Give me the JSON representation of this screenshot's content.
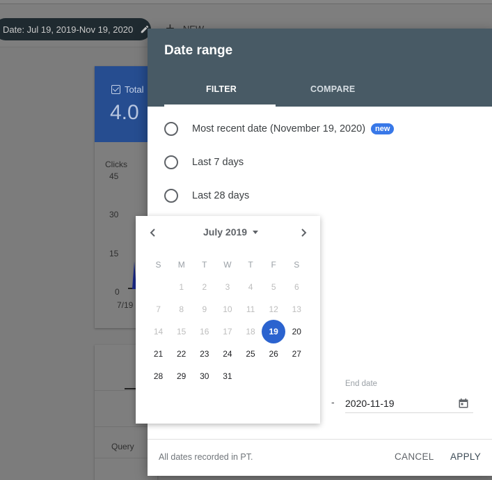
{
  "background": {
    "date_chip": "Date: Jul 19, 2019-Nov 19, 2020",
    "new_button": "NEW",
    "metric_card": {
      "checkbox_label": "Total",
      "value_partial": "4.0",
      "chart_label": "Clicks",
      "y_ticks": [
        "45",
        "30",
        "15",
        "0"
      ],
      "x_tick_partial": "7/19"
    },
    "table": {
      "header_partial": "Query"
    },
    "colors": {
      "card_accent": "#264d90"
    }
  },
  "dialog": {
    "title": "Date range",
    "tabs": [
      {
        "label": "FILTER",
        "active": true
      },
      {
        "label": "COMPARE",
        "active": false
      }
    ],
    "options": [
      {
        "label": "Most recent date (November 19, 2020)",
        "badge": "new",
        "selected": false
      },
      {
        "label": "Last 7 days",
        "selected": false
      },
      {
        "label": "Last 28 days",
        "selected": false
      }
    ],
    "end_date": {
      "label": "End date",
      "value": "2020-11-19",
      "separator": "-"
    },
    "footer_note": "All dates recorded in PT.",
    "cancel_label": "CANCEL",
    "apply_label": "APPLY",
    "colors": {
      "header_bg": "#485a65",
      "badge": "#3878e8"
    }
  },
  "calendar": {
    "month_label": "July 2019",
    "weekdays": [
      "S",
      "M",
      "T",
      "W",
      "T",
      "F",
      "S"
    ],
    "weeks": [
      [
        "",
        "1",
        "2",
        "3",
        "4",
        "5",
        "6"
      ],
      [
        "7",
        "8",
        "9",
        "10",
        "11",
        "12",
        "13"
      ],
      [
        "14",
        "15",
        "16",
        "17",
        "18",
        "19",
        "20"
      ],
      [
        "21",
        "22",
        "23",
        "24",
        "25",
        "26",
        "27"
      ],
      [
        "28",
        "29",
        "30",
        "31",
        "",
        "",
        ""
      ]
    ],
    "selected_day": "19",
    "first_enabled_day": 19,
    "selected_color": "#2b63cf"
  }
}
